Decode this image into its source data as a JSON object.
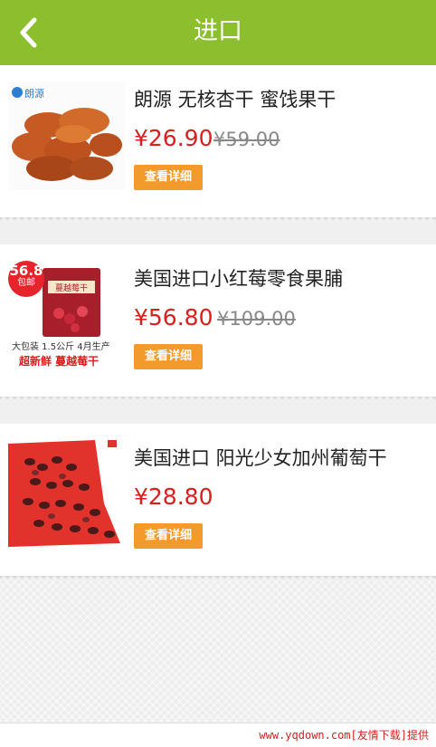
{
  "header": {
    "title": "进口",
    "back_icon": "chevron-left-icon",
    "bg_color": "#8cbf2d"
  },
  "products": [
    {
      "name": "朗源 无核杏干 蜜饯果干",
      "price": "¥26.90",
      "original_price": "¥59.00",
      "detail_label": "查看详细",
      "image": {
        "brand": "朗源"
      }
    },
    {
      "name": "美国进口小红莓零食果脯",
      "price": "¥56.80",
      "original_price": "¥109.00",
      "detail_label": "查看详细",
      "image": {
        "badge_price": "56.8",
        "badge_sub": "包邮",
        "package_label": "蔓越莓干",
        "caption_small": "大包装 1.5公斤 4月生产",
        "caption_red": "超新鲜 蔓越莓干"
      }
    },
    {
      "name": "美国进口 阳光少女加州葡萄干",
      "price": "¥28.80",
      "detail_label": "查看详细",
      "image": {}
    }
  ],
  "footer": {
    "watermark": "www.yqdown.com[友情下载]提供"
  },
  "colors": {
    "price": "#d9201d",
    "button": "#f39a2c"
  }
}
